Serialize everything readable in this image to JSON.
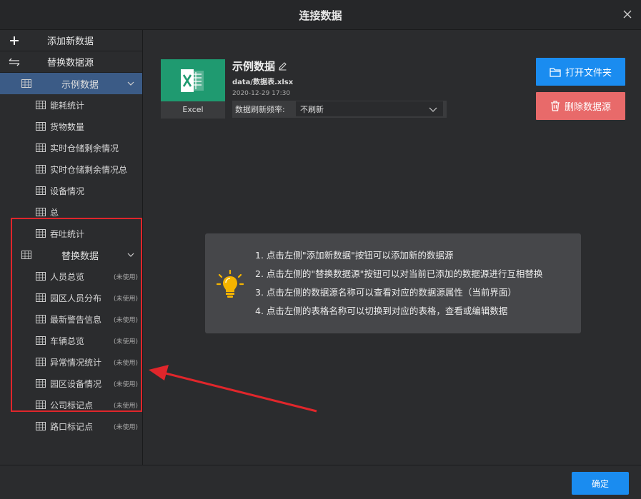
{
  "dialog": {
    "title": "连接数据",
    "ok_label": "确定"
  },
  "sidebar": {
    "add_label": "添加新数据",
    "replace_label": "替换数据源",
    "sources": [
      {
        "name": "示例数据",
        "active": true,
        "tables": [
          {
            "name": "能耗统计",
            "tag": ""
          },
          {
            "name": "货物数量",
            "tag": ""
          },
          {
            "name": "实时仓储剩余情况",
            "tag": ""
          },
          {
            "name": "实时仓储剩余情况总",
            "tag": ""
          },
          {
            "name": "设备情况",
            "tag": ""
          },
          {
            "name": "总",
            "tag": ""
          },
          {
            "name": "吞吐统计",
            "tag": ""
          }
        ]
      },
      {
        "name": "替换数据",
        "active": false,
        "tables": [
          {
            "name": "人员总览",
            "tag": "(未使用)"
          },
          {
            "name": "园区人员分布",
            "tag": "(未使用)"
          },
          {
            "name": "最新警告信息",
            "tag": "(未使用)"
          },
          {
            "name": "车辆总览",
            "tag": "(未使用)"
          },
          {
            "name": "异常情况统计",
            "tag": "(未使用)"
          },
          {
            "name": "园区设备情况",
            "tag": "(未使用)"
          },
          {
            "name": "公司标记点",
            "tag": "(未使用)"
          },
          {
            "name": "路口标记点",
            "tag": "(未使用)"
          }
        ]
      }
    ]
  },
  "detail": {
    "file_type": "Excel",
    "name": "示例数据",
    "path": "data/数据表.xlsx",
    "time": "2020-12-29 17:30",
    "refresh_label": "数据刷新频率:",
    "refresh_value": "不刷新",
    "open_label": "打开文件夹",
    "delete_label": "删除数据源"
  },
  "tips": [
    "1. 点击左侧\"添加新数据\"按钮可以添加新的数据源",
    "2. 点击左侧的\"替换数据源\"按钮可以对当前已添加的数据源进行互相替换",
    "3. 点击左侧的数据源名称可以查看对应的数据源属性（当前界面）",
    "4. 点击左侧的表格名称可以切换到对应的表格，查看或编辑数据"
  ],
  "colors": {
    "accent": "#1a8cf0",
    "danger": "#e86a6a",
    "excel": "#1f9a70",
    "active_row": "#3b5b86",
    "annotation": "#e0262b"
  }
}
